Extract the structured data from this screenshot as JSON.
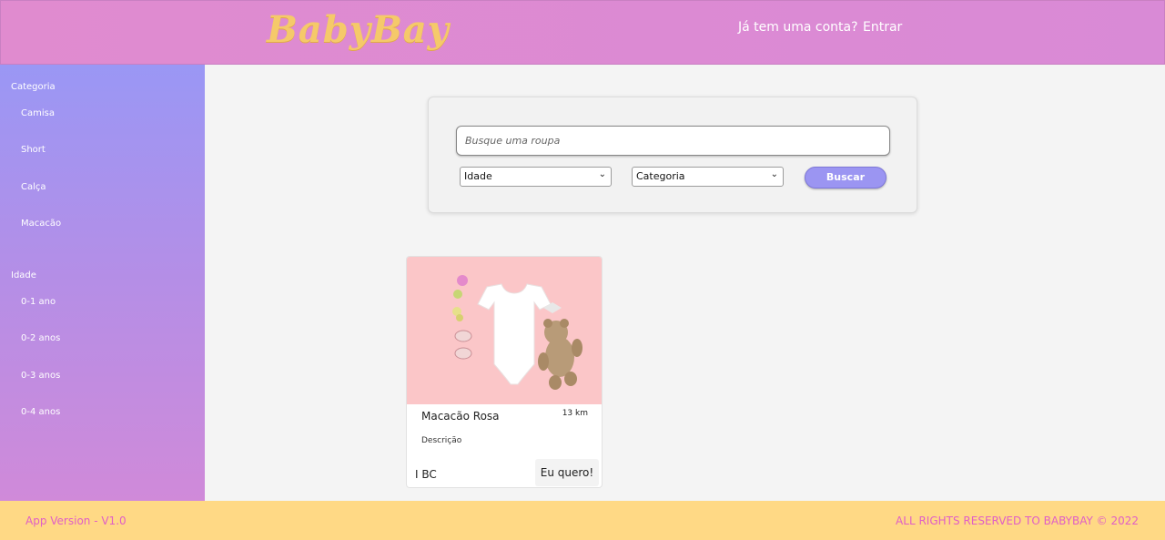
{
  "header": {
    "logo": "BabyBay",
    "question": "Já tem uma conta?",
    "login": "Entrar"
  },
  "sidebar": {
    "category_title": "Categoria",
    "categories": [
      "Camisa",
      "Short",
      "Calça",
      "Macacão"
    ],
    "age_title": "Idade",
    "ages": [
      "0-1 ano",
      "0-2 anos",
      "0-3 anos",
      "0-4 anos"
    ]
  },
  "search": {
    "placeholder": "Busque uma roupa",
    "age_select": "Idade",
    "category_select": "Categoria",
    "button": "Buscar"
  },
  "product": {
    "title": "Macacão Rosa",
    "distance": "13 km",
    "description": "Descrição",
    "location": "I BC",
    "button": "Eu quero!"
  },
  "footer": {
    "version": "App Version - V1.0",
    "rights": "ALL RIGHTS RESERVED TO BABYBAY © 2022"
  },
  "colors": {
    "header": "#dd8bd3",
    "sidebar_top": "#9a97f5",
    "sidebar_bottom": "#d08ad9",
    "accent": "#9b95f2",
    "footer": "#ffd985",
    "footer_text": "#e05ec6",
    "logo": "#f5c96a"
  }
}
